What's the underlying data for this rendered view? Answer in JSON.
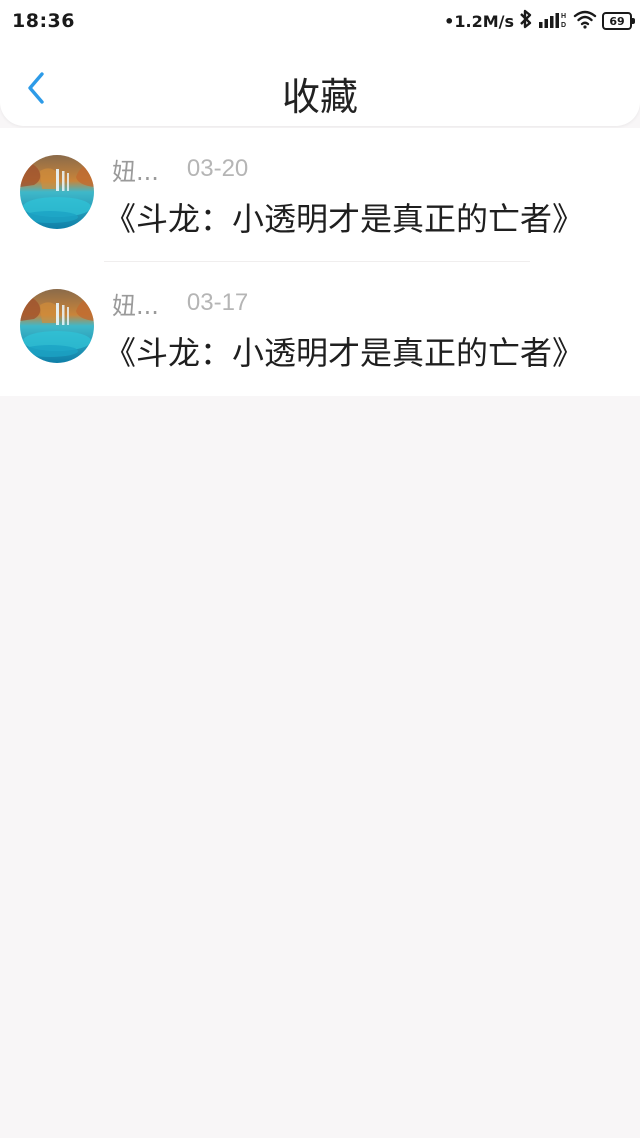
{
  "status_bar": {
    "time": "18:36",
    "net_speed": "•1.2M/s",
    "bluetooth_icon": "bluetooth-icon",
    "signal_icon": "signal-icon",
    "wifi_icon": "wifi-icon",
    "battery": "69"
  },
  "nav": {
    "back_icon": "chevron-left-icon",
    "title": "收藏",
    "accent_color": "#2d9be8"
  },
  "favorites": [
    {
      "author": "妞...",
      "date": "03-20",
      "title": "《斗龙：小透明才是真正的亡者》"
    },
    {
      "author": "妞...",
      "date": "03-17",
      "title": "《斗龙：小透明才是真正的亡者》"
    }
  ]
}
